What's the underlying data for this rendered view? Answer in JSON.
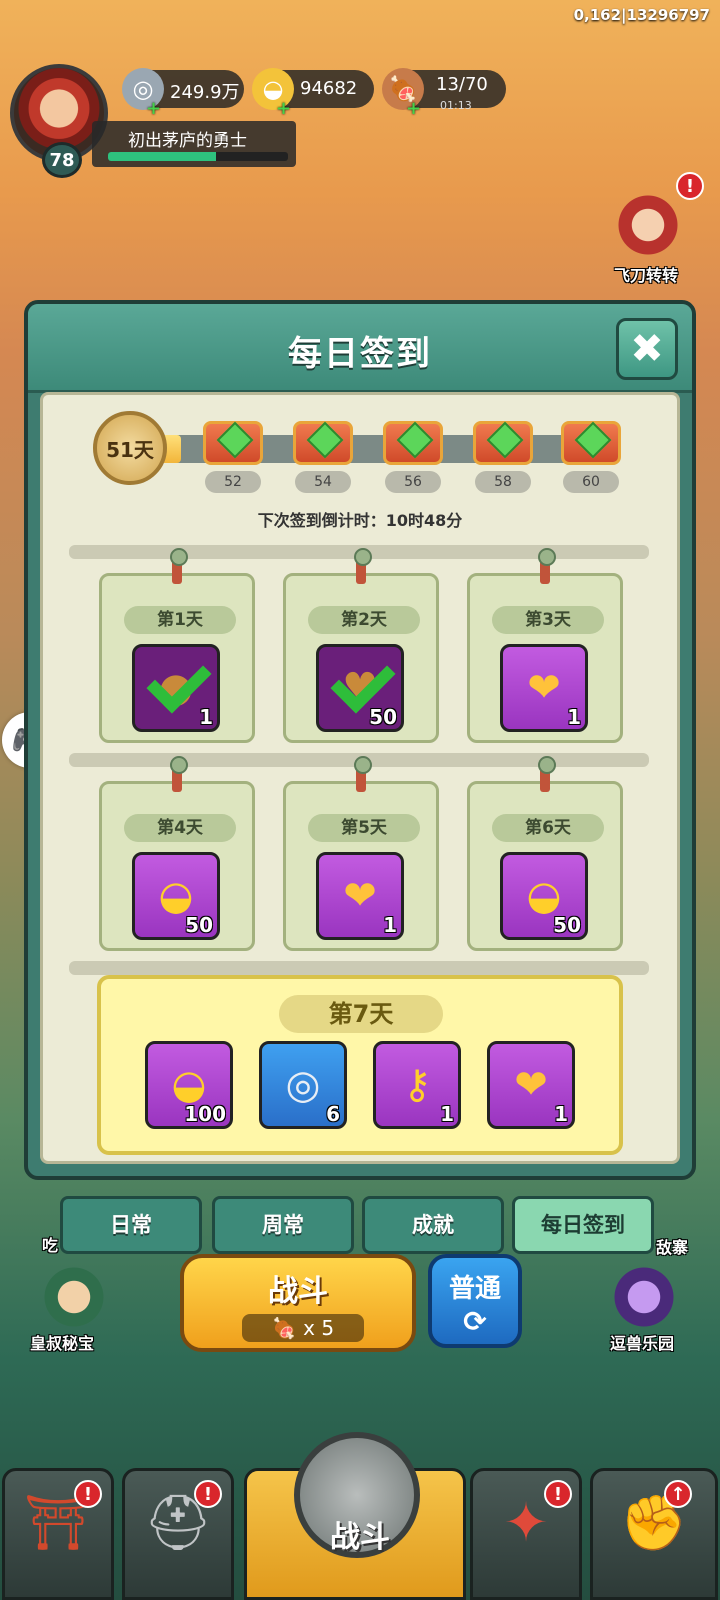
{
  "debug_text": "0,162|13296797",
  "player": {
    "level": "78",
    "title": "初出茅庐的勇士",
    "xp_progress": 0.6
  },
  "resources": [
    {
      "name": "silver-coin",
      "value": "249.9万",
      "plus": "+"
    },
    {
      "name": "gold-ingot",
      "value": "94682",
      "plus": "+"
    },
    {
      "name": "stamina-meat",
      "value": "13/70",
      "timer": "01:13",
      "plus": "+"
    }
  ],
  "side": {
    "flying_knife": "飞刀转转",
    "secret_treasure": "皇叔秘宝",
    "beast_park": "逗兽乐园",
    "left_hidden": "吃",
    "right_hidden": "敌寨",
    "alert": "!"
  },
  "modal": {
    "title": "每日签到",
    "close": "✖",
    "days_signed": "51天",
    "progress": 0.06,
    "chests": [
      "52",
      "54",
      "56",
      "58",
      "60"
    ],
    "countdown": "下次签到倒计时：10时48分",
    "days": [
      {
        "label": "第1天",
        "qty": "1",
        "claimed": true,
        "icon": "cookie-icon"
      },
      {
        "label": "第2天",
        "qty": "50",
        "claimed": true,
        "icon": "heart-icon"
      },
      {
        "label": "第3天",
        "qty": "1",
        "claimed": false,
        "icon": "heart-coin-icon"
      },
      {
        "label": "第4天",
        "qty": "50",
        "claimed": false,
        "icon": "gold-ingot-icon"
      },
      {
        "label": "第5天",
        "qty": "1",
        "claimed": false,
        "icon": "heart-coin-icon"
      },
      {
        "label": "第6天",
        "qty": "50",
        "claimed": false,
        "icon": "gold-ingot-icon"
      }
    ],
    "day7": {
      "label": "第7天",
      "items": [
        {
          "qty": "100",
          "icon": "gold-ingot-icon"
        },
        {
          "qty": "6",
          "icon": "silver-coin-icon"
        },
        {
          "qty": "1",
          "icon": "key-icon"
        },
        {
          "qty": "1",
          "icon": "heart-coin-icon"
        }
      ]
    }
  },
  "tabs": [
    "日常",
    "周常",
    "成就",
    "每日签到"
  ],
  "battle": {
    "label": "战斗",
    "cost": "x 5",
    "mode": "普通",
    "refresh": "⟳"
  },
  "bottom_nav": {
    "center_label": "战斗",
    "alert": "!",
    "up": "↑"
  },
  "colors": {
    "accent": "#3d8a79",
    "gold": "#f0a01c",
    "purple": "#9a35c0",
    "alert": "#d9262c"
  }
}
